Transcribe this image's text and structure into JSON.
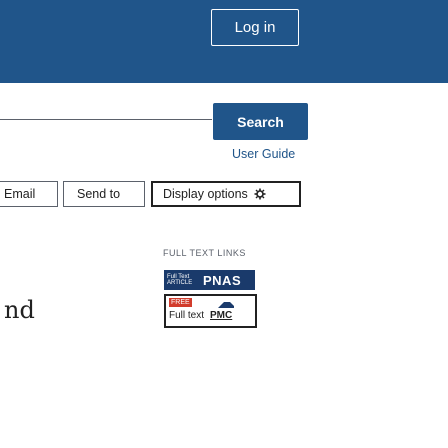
{
  "header": {
    "login_label": "Log in"
  },
  "search": {
    "button_label": "Search",
    "user_guide_label": "User Guide"
  },
  "toolbar": {
    "email_label": "Email",
    "send_to_label": "Send to",
    "display_options_label": "Display options",
    "gear_icon": "gear-icon"
  },
  "full_text_links": {
    "heading": "FULL TEXT LINKS",
    "pnas": {
      "left_line1": "Full Text",
      "left_line2": "ARTICLE",
      "right_text": "PNAS"
    },
    "pmc": {
      "free_badge": "FREE",
      "full_text": "Full text",
      "pmc_text": "PMC"
    }
  },
  "article": {
    "title_fragment": "nd"
  },
  "colors": {
    "header_bg": "#20558a",
    "primary_button": "#20558a",
    "pnas_bg": "#1a3a6b",
    "free_badge": "#d23c2c"
  }
}
